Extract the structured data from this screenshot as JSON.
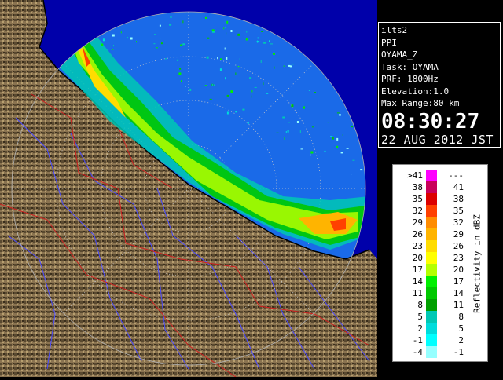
{
  "info": {
    "product": "ilts2",
    "type": "PPI",
    "station": "OYAMA_Z",
    "task": "Task: OYAMA",
    "prf": "PRF: 1800Hz",
    "elevation": "Elevation:1.0",
    "range": "Max Range:80 km",
    "time": "08:30:27",
    "date": "22 AUG 2012 JST"
  },
  "legend": {
    "unit_label": "Reflectivity in dBZ",
    "rows": [
      {
        "lo": ">41",
        "hi": "---",
        "color": "#ff00ff"
      },
      {
        "lo": "38",
        "hi": "41",
        "color": "#c8005a"
      },
      {
        "lo": "35",
        "hi": "38",
        "color": "#dc0000"
      },
      {
        "lo": "32",
        "hi": "35",
        "color": "#ff4000"
      },
      {
        "lo": "29",
        "hi": "32",
        "color": "#ff8c00"
      },
      {
        "lo": "26",
        "hi": "29",
        "color": "#ffb400"
      },
      {
        "lo": "23",
        "hi": "26",
        "color": "#ffdc00"
      },
      {
        "lo": "20",
        "hi": "23",
        "color": "#ffff00"
      },
      {
        "lo": "17",
        "hi": "20",
        "color": "#b4ff00"
      },
      {
        "lo": "14",
        "hi": "17",
        "color": "#00f000"
      },
      {
        "lo": "11",
        "hi": "14",
        "color": "#00c800"
      },
      {
        "lo": "8",
        "hi": "11",
        "color": "#00a000"
      },
      {
        "lo": "5",
        "hi": "8",
        "color": "#00c8b4"
      },
      {
        "lo": "2",
        "hi": "5",
        "color": "#00dcdc"
      },
      {
        "lo": "-1",
        "hi": "2",
        "color": "#00ffff"
      },
      {
        "lo": "-4",
        "hi": "-1",
        "color": "#96ffff"
      }
    ]
  },
  "colors": {
    "sea": "#1a6ae8",
    "outside_range": "#0000aa",
    "land": "#8a7350",
    "rivers": "#4040ff",
    "boundaries": "#d02020"
  }
}
